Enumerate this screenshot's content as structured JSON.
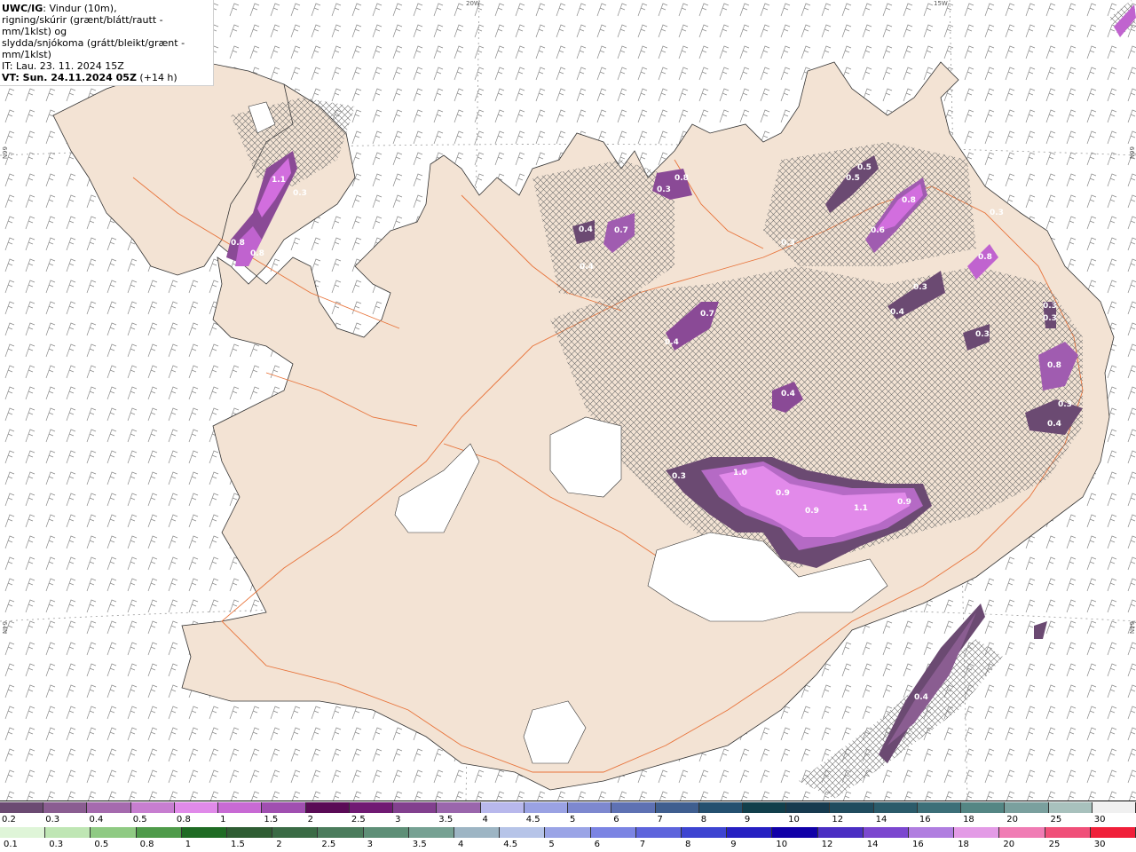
{
  "info": {
    "line1_bold": "UWC/IG",
    "line1_rest": ": Vindur (10m),",
    "line2": "rigning/skúrir (grænt/blátt/rautt - mm/1klst) og",
    "line3": "slydda/snjókoma (grátt/bleikt/grænt - mm/1klst)",
    "line4": "IT: Lau. 23. 11. 2024 15Z",
    "line5_bold": "VT: Sun. 24.11.2024 05Z",
    "line5_rest": " (+14 h)"
  },
  "coords": {
    "top_20w": "20W",
    "top_15w": "15W",
    "left_66n": "66N",
    "right_66n": "66N",
    "left_64n": "64N",
    "right_64n": "64N"
  },
  "precip_labels": [
    "1.1",
    "0.8",
    "0.3",
    "0.8",
    "0.4",
    "0.4",
    "0.7",
    "0.3",
    "0.8",
    "0.3",
    "0.5",
    "0.5",
    "0.8",
    "0.6",
    "0.3",
    "0.8",
    "0.3",
    "0.4",
    "0.7",
    "0.4",
    "0.3",
    "0.3",
    "0.3",
    "0.8",
    "0.4",
    "0.3",
    "0.4",
    "0.3",
    "1.0",
    "0.9",
    "0.9",
    "1.1",
    "0.9",
    "0.4"
  ],
  "snow_scale": {
    "labels": [
      "0.2",
      "0.3",
      "0.4",
      "0.5",
      "0.8",
      "1",
      "1.5",
      "2",
      "2.5",
      "3",
      "3.5",
      "4",
      "4.5",
      "5",
      "6",
      "7",
      "8",
      "9",
      "10",
      "12",
      "14",
      "16",
      "18",
      "20",
      "25",
      "30"
    ],
    "colors": [
      "#6b4a72",
      "#8a5d91",
      "#a56aae",
      "#c77ed0",
      "#e08ae9",
      "#c86ad4",
      "#a04fb0",
      "#5a0b56",
      "#701a73",
      "#82408e",
      "#9a66ac",
      "#b8b8ec",
      "#9aa2e3",
      "#7d88cf",
      "#5e71b3",
      "#3f5e8f",
      "#24506f",
      "#123f4b",
      "#173a4e",
      "#204c5e",
      "#2b5b6a",
      "#3c6f78",
      "#548684",
      "#7aa09e",
      "#a8c1bd",
      "#f0f0f0"
    ]
  },
  "rain_scale": {
    "labels": [
      "0.1",
      "0.3",
      "0.5",
      "0.8",
      "1",
      "1.5",
      "2",
      "2.5",
      "3",
      "3.5",
      "4",
      "4.5",
      "5",
      "6",
      "7",
      "8",
      "9",
      "10",
      "12",
      "14",
      "16",
      "18",
      "20",
      "25",
      "30"
    ],
    "colors": [
      "#dff5d8",
      "#bfe6b4",
      "#8fca83",
      "#4f9b4a",
      "#1f6b24",
      "#2f5d33",
      "#3a6b45",
      "#4b7c5c",
      "#5e8f77",
      "#76a193",
      "#9db5c4",
      "#b6c4e8",
      "#9aa4e6",
      "#7b84e3",
      "#5d64dc",
      "#3d44d1",
      "#2620c2",
      "#1100a8",
      "#4a2ec3",
      "#7b47cf",
      "#b07ee0",
      "#e39be6",
      "#f07cb4",
      "#f05079",
      "#f0203a"
    ]
  }
}
